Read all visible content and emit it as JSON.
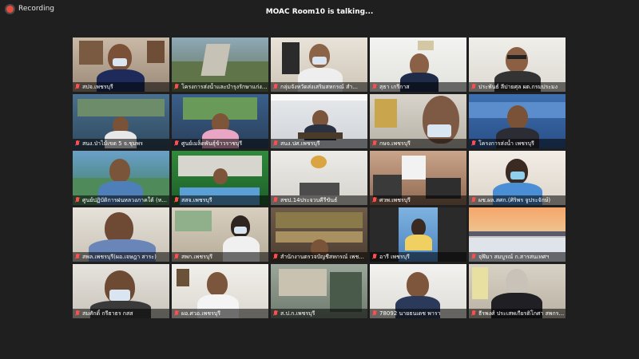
{
  "header": {
    "recording_label": "Recording",
    "talking_text": "MOAC Room10 is talking..."
  },
  "participants": [
    "สปจ.เพชรบุรี",
    "โครงการส่งน้ำและบำรุงรักษาแก่งก...",
    "กลุ่มจังหวัดส่งเสริมสหกรณ์ สำ...",
    "สุธา เกรีกาส",
    "ประพันธ์ ลีปายศุล ผต.กรมประมง",
    "สนง.ป่าไม้เขต 5 จ.ชุมพร",
    "ศูนย์เมล็ดพันธุ์ข้าวราชบุรี",
    "สนง.ปศ.เพชรบุรี",
    "กษจ.เพชรบุรี",
    "โครงการส่งน้ำ เพชรบุรี",
    "ศูนย์ปฏิบัติการฝนหลวงภาคใต้ (ห...",
    "สสจ.เพชรบุรี",
    "สชป.14ประจวบคีรีขันธ์",
    "ศวพ.เพชรบุรี",
    "ผช.ผล.สศก.(ศิริพร จูประจักษ์)",
    "สพล.เพชรบุรี(ผอ.เจษฎา สาระ)",
    "สพก.เพชรบุรี",
    "สำนักงานตรวจบัญชีสหกรณ์ เพช...",
    "อารี เพชรบุรี",
    "จุฬิมา สมบูรณ์ ก.สารสนเทศฯ",
    "สมศักดิ์ กรีธาธร กสส",
    "ผอ.ศวอ.เพชรบุรี",
    "ส.ป.ก.เพชรบุรี",
    "78092 นายธนเดช พารา",
    "ธีรพงศ์ ประเสพเกียรติโกศา สพกร..."
  ],
  "icons": {
    "mic": "mic-muted-icon",
    "record": "record-dot-icon"
  },
  "colors": {
    "background": "#1f1f1f",
    "record": "#e74c3c",
    "mic_muted": "#ff4d4d"
  }
}
